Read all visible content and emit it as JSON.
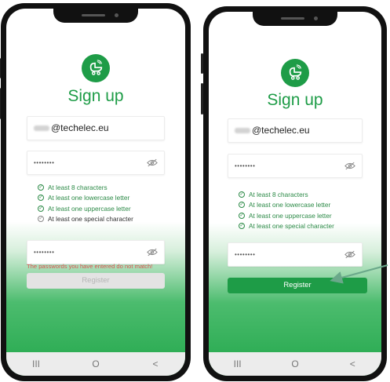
{
  "colors": {
    "brand": "#1e9c47",
    "error": "#d9534f",
    "disabled": "#e3e3e3"
  },
  "left_phone": {
    "title": "Sign up",
    "email_value": "@techelec.eu",
    "password_mask": "••••••••",
    "confirm_mask": "••••••••",
    "rules": [
      {
        "label": "At least 8 characters",
        "met": true
      },
      {
        "label": "At least one lowercase letter",
        "met": true
      },
      {
        "label": "At least one uppercase letter",
        "met": true
      },
      {
        "label": "At least one special character",
        "met": false
      }
    ],
    "error_text": "The passwords you have entered do not match!",
    "register_label": "Register",
    "register_enabled": false,
    "nav": {
      "recents": "III",
      "home": "O",
      "back": "<"
    }
  },
  "right_phone": {
    "title": "Sign up",
    "email_value": "@techelec.eu",
    "password_mask": "••••••••",
    "confirm_mask": "••••••••",
    "rules": [
      {
        "label": "At least 8 characters",
        "met": true
      },
      {
        "label": "At least one lowercase letter",
        "met": true
      },
      {
        "label": "At least one uppercase letter",
        "met": true
      },
      {
        "label": "At least one special character",
        "met": true
      }
    ],
    "register_label": "Register",
    "register_enabled": true,
    "nav": {
      "recents": "III",
      "home": "O",
      "back": "<"
    }
  },
  "icons": {
    "logo": "baby-stroller-icon",
    "visibility": "eye-off-icon",
    "rule_check": "check-circle-icon"
  }
}
